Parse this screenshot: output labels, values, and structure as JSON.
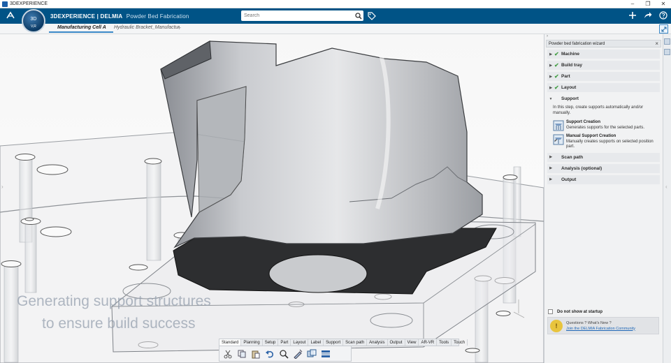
{
  "os": {
    "title": "3DEXPERIENCE",
    "controls": [
      "–",
      "❐",
      "✕"
    ]
  },
  "header": {
    "brand_bold": "3DEXPERIENCE | DELMIA",
    "app_name": "Powder Bed Fabrication",
    "search_placeholder": "Search"
  },
  "compass": {
    "top": "3D",
    "bottom": "V,R"
  },
  "tabs": [
    {
      "label": "Manufacturing Cell A",
      "active": true
    },
    {
      "label": "Hydraulic Bracket_Manufactur",
      "active": false
    }
  ],
  "captions": [
    "Generating support structures",
    "to ensure build success"
  ],
  "action_bar": {
    "tabs": [
      "Standard",
      "Planning",
      "Setup",
      "Part",
      "Layout",
      "Label",
      "Support",
      "Scan path",
      "Analysis",
      "Output",
      "View",
      "AR-VR",
      "Tools",
      "Touch"
    ],
    "active_tab": "Standard"
  },
  "wizard": {
    "title": "Powder bed fabrication wizard",
    "steps_done": [
      "Machine",
      "Build tray",
      "Part",
      "Layout"
    ],
    "current_step": {
      "label": "Support",
      "intro": "In this step, create supports automatically and/or manually.",
      "options": [
        {
          "title": "Support Creation",
          "desc": "Generates supports for the selected parts."
        },
        {
          "title": "Manual Support Creation",
          "desc": "Manually creates supports on selected position part."
        }
      ]
    },
    "steps_pending": [
      "Scan path",
      "Analysis (optional)",
      "Output"
    ],
    "dont_show": "Do not show at startup",
    "questions": "Questions ? What's New ?",
    "community_link": "Join the DELMIA Fabrication Community"
  },
  "colors": {
    "header": "#005386",
    "accent": "#3b88c7",
    "check": "#46a048"
  }
}
